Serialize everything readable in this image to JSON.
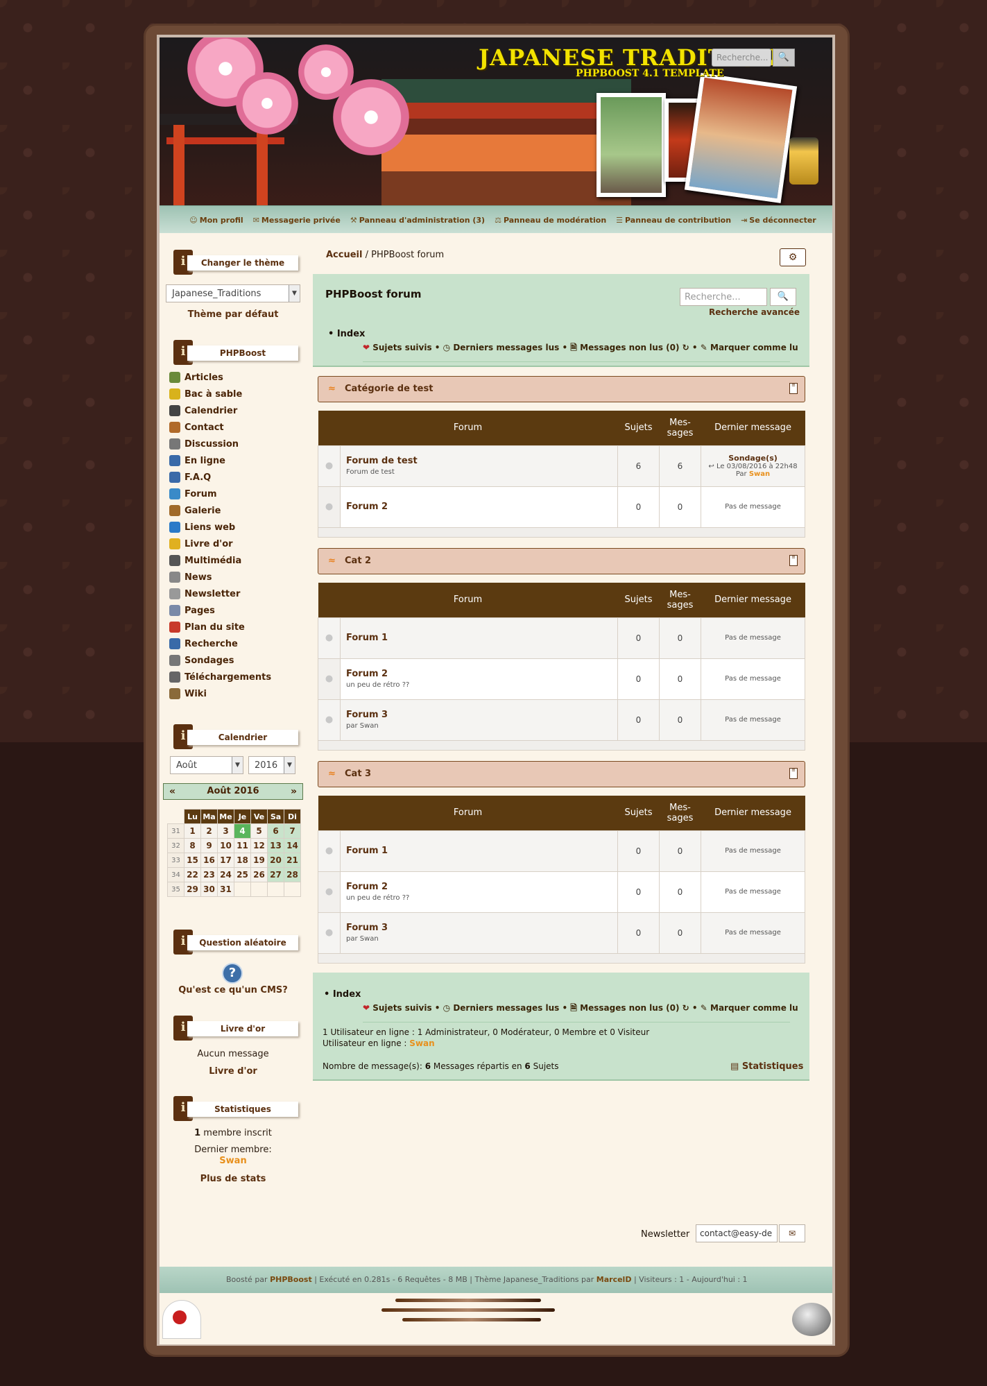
{
  "header": {
    "site_title": "JAPANESE TRADITIONS",
    "site_subtitle": "PHPBOOST 4.1 TEMPLATE",
    "search_placeholder": "Recherche..."
  },
  "user_nav": [
    {
      "icon": "user-icon",
      "label": "Mon profil"
    },
    {
      "icon": "envelope-icon",
      "label": "Messagerie privée"
    },
    {
      "icon": "wrench-icon",
      "label": "Panneau d'administration (3)"
    },
    {
      "icon": "gavel-icon",
      "label": "Panneau de modération"
    },
    {
      "icon": "file-icon",
      "label": "Panneau de contribution"
    },
    {
      "icon": "sign-out-icon",
      "label": "Se déconnecter"
    }
  ],
  "sidebar": {
    "theme_block": {
      "title": "Changer le thème",
      "selected": "Japanese_Traditions",
      "default_link": "Thème par défaut"
    },
    "menu_block": {
      "title": "PHPBoost",
      "items": [
        {
          "label": "Articles",
          "icon": "articles-icon"
        },
        {
          "label": "Bac à sable",
          "icon": "sandbox-icon"
        },
        {
          "label": "Calendrier",
          "icon": "calendar-icon"
        },
        {
          "label": "Contact",
          "icon": "contact-icon"
        },
        {
          "label": "Discussion",
          "icon": "chat-icon"
        },
        {
          "label": "En ligne",
          "icon": "online-icon"
        },
        {
          "label": "F.A.Q",
          "icon": "faq-icon"
        },
        {
          "label": "Forum",
          "icon": "forum-icon"
        },
        {
          "label": "Galerie",
          "icon": "gallery-icon"
        },
        {
          "label": "Liens web",
          "icon": "weblinks-icon"
        },
        {
          "label": "Livre d'or",
          "icon": "guestbook-icon"
        },
        {
          "label": "Multimédia",
          "icon": "media-icon"
        },
        {
          "label": "News",
          "icon": "news-icon"
        },
        {
          "label": "Newsletter",
          "icon": "newsletter-icon"
        },
        {
          "label": "Pages",
          "icon": "pages-icon"
        },
        {
          "label": "Plan du site",
          "icon": "sitemap-icon"
        },
        {
          "label": "Recherche",
          "icon": "search-icon"
        },
        {
          "label": "Sondages",
          "icon": "poll-icon"
        },
        {
          "label": "Téléchargements",
          "icon": "download-icon"
        },
        {
          "label": "Wiki",
          "icon": "wiki-icon"
        }
      ]
    },
    "calendar_block": {
      "title": "Calendrier",
      "month_select": "Août",
      "year_select": "2016",
      "heading": "Août 2016",
      "prev": "«",
      "next": "»",
      "days": [
        "Lu",
        "Ma",
        "Me",
        "Je",
        "Ve",
        "Sa",
        "Di"
      ],
      "today": 4,
      "weeks": [
        {
          "num": "31",
          "days": [
            "1",
            "2",
            "3",
            "4",
            "5",
            "6",
            "7"
          ]
        },
        {
          "num": "32",
          "days": [
            "8",
            "9",
            "10",
            "11",
            "12",
            "13",
            "14"
          ]
        },
        {
          "num": "33",
          "days": [
            "15",
            "16",
            "17",
            "18",
            "19",
            "20",
            "21"
          ]
        },
        {
          "num": "34",
          "days": [
            "22",
            "23",
            "24",
            "25",
            "26",
            "27",
            "28"
          ]
        },
        {
          "num": "35",
          "days": [
            "29",
            "30",
            "31",
            "",
            "",
            "",
            ""
          ]
        }
      ]
    },
    "question_block": {
      "title": "Question aléatoire",
      "question": "Qu'est ce qu'un CMS?"
    },
    "guestbook_block": {
      "title": "Livre d'or",
      "text": "Aucun message",
      "link": "Livre d'or"
    },
    "stats_block": {
      "title": "Statistiques",
      "count": "1",
      "count_suffix": " membre inscrit",
      "last_member_label": "Dernier membre:",
      "last_member": "Swan",
      "more": "Plus de stats"
    }
  },
  "breadcrumb": {
    "home": "Accueil",
    "sep": " / ",
    "current": "PHPBoost forum"
  },
  "forum": {
    "title": "PHPBoost forum",
    "search_placeholder": "Recherche...",
    "advanced_search": "Recherche avancée",
    "index": "• Index",
    "actions": {
      "followed": "Sujets suivis",
      "last_read": "Derniers messages lus",
      "unread": "Messages non lus (0)",
      "mark_read": "Marquer comme lu"
    },
    "columns": {
      "forum": "Forum",
      "topics": "Sujets",
      "messages": "Mes-\nsages",
      "last": "Dernier message"
    },
    "categories": [
      {
        "name": "Catégorie de test",
        "forums": [
          {
            "name": "Forum de test",
            "desc": "Forum de test",
            "topics": "6",
            "messages": "6",
            "last": {
              "title": "Sondage(s)",
              "date": "Le 03/08/2016 à 22h48",
              "by": "Par ",
              "user": "Swan"
            }
          },
          {
            "name": "Forum 2",
            "desc": "",
            "topics": "0",
            "messages": "0",
            "last_text": "Pas de message"
          }
        ]
      },
      {
        "name": "Cat 2",
        "forums": [
          {
            "name": "Forum 1",
            "desc": "",
            "topics": "0",
            "messages": "0",
            "last_text": "Pas de message"
          },
          {
            "name": "Forum 2",
            "desc": "un peu de rétro ??",
            "topics": "0",
            "messages": "0",
            "last_text": "Pas de message"
          },
          {
            "name": "Forum 3",
            "desc": "par Swan",
            "topics": "0",
            "messages": "0",
            "last_text": "Pas de message"
          }
        ]
      },
      {
        "name": "Cat 3",
        "forums": [
          {
            "name": "Forum 1",
            "desc": "",
            "topics": "0",
            "messages": "0",
            "last_text": "Pas de message"
          },
          {
            "name": "Forum 2",
            "desc": "un peu de rétro ??",
            "topics": "0",
            "messages": "0",
            "last_text": "Pas de message"
          },
          {
            "name": "Forum 3",
            "desc": "par Swan",
            "topics": "0",
            "messages": "0",
            "last_text": "Pas de message"
          }
        ]
      }
    ],
    "online": {
      "line1": "1 Utilisateur en ligne : 1 Administrateur, 0 Modérateur, 0 Membre et 0 Visiteur",
      "line2_label": "Utilisateur en ligne : ",
      "line2_user": "Swan"
    },
    "totals": {
      "prefix": "Nombre de message(s): ",
      "messages": "6",
      "mid": " Messages répartis en ",
      "topics": "6",
      "suffix": " Sujets"
    },
    "stats_link": "Statistiques"
  },
  "newsletter": {
    "label": "Newsletter",
    "value": "contact@easy-de"
  },
  "footer": {
    "boosted_prefix": "Boosté par ",
    "boosted_name": "PHPBoost",
    "exec": " | Exécuté en 0.281s - 6 Requêtes - 8 MB | Thème Japanese_Traditions par ",
    "author": "MarcelD",
    "visitors": " | Visiteurs : 1 - Aujourd'hui : 1"
  }
}
